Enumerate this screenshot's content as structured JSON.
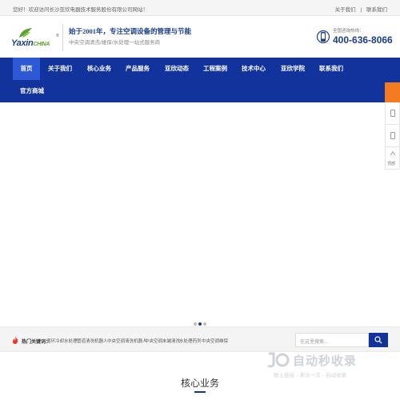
{
  "topbar": {
    "welcome": "您好！欢迎访问长沙亚欣电器技术服务股份有限公司网站！",
    "about": "关于我们",
    "separator": "|",
    "contact": "联系我们"
  },
  "header": {
    "logo_text_a": "Yaxin",
    "logo_text_b": "CHINA",
    "logo_reg": "®",
    "slogan_main": "始于2001年，专注空调设备的管理与节能",
    "slogan_sub": "中央空调清洗/維保/水处理一站式服务商",
    "phone_label": "全国咨询热线：",
    "phone_number": "400-636-8066"
  },
  "nav": {
    "items": [
      "首页",
      "关于我们",
      "核心业务",
      "产品服务",
      "亚欣动态",
      "工程案例",
      "技术中心",
      "亚欣学院",
      "联系我们",
      "官方商城"
    ]
  },
  "side": {
    "top_label": "",
    "last_label": "顶部"
  },
  "hotbar": {
    "label": "热门关键词：",
    "keywords": [
      "循环冷却水处理",
      "管道清洗机器人",
      "中央空调清洗机器人",
      "中央空调末端清洗",
      "水处理药剂",
      "中央空调维保"
    ],
    "search_placeholder": "在这里搜索..."
  },
  "section": {
    "core_title": "核心业务"
  },
  "watermark": {
    "title": "自动秒收录",
    "sub": "数上链接→来访一次→自动收录"
  },
  "colors": {
    "primary": "#12329c",
    "nav_active": "#2d58d6",
    "accent_orange": "#f47b20",
    "logo_green": "#5da032"
  }
}
